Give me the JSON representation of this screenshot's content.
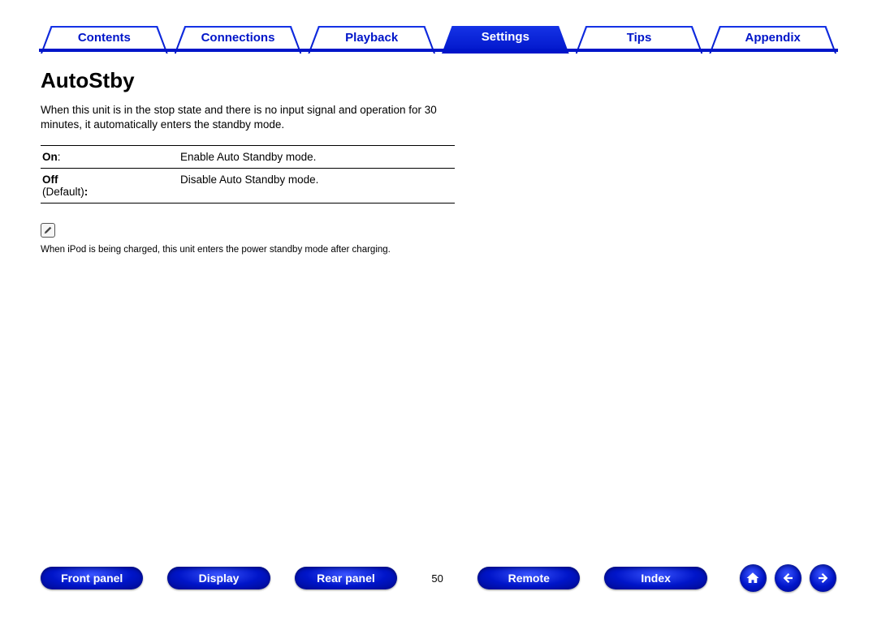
{
  "tabs": {
    "items": [
      {
        "label": "Contents",
        "active": false
      },
      {
        "label": "Connections",
        "active": false
      },
      {
        "label": "Playback",
        "active": false
      },
      {
        "label": "Settings",
        "active": true
      },
      {
        "label": "Tips",
        "active": false
      },
      {
        "label": "Appendix",
        "active": false
      }
    ]
  },
  "page": {
    "title": "AutoStby",
    "description": "When this unit is in the stop state and there is no input signal and operation for 30 minutes, it automatically enters the standby mode.",
    "options": [
      {
        "name": "On",
        "suffix": ":",
        "value": "Enable Auto Standby mode."
      },
      {
        "name": "Off",
        "suffix": "\n(Default):",
        "value": "Disable Auto Standby mode."
      }
    ],
    "noteIcon": "pencil-icon",
    "note": "When iPod is being charged, this unit enters the power standby mode after charging."
  },
  "footer": {
    "buttons": [
      "Front panel",
      "Display",
      "Rear panel"
    ],
    "pageNumber": "50",
    "buttons2": [
      "Remote",
      "Index"
    ],
    "circles": [
      "home-icon",
      "arrow-left-icon",
      "arrow-right-icon"
    ]
  }
}
